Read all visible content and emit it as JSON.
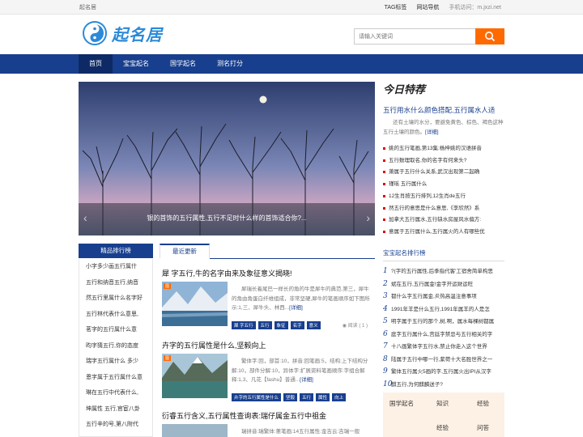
{
  "topbar": {
    "site": "起名居",
    "tag_link": "TAG标签",
    "site_nav": "网站导航",
    "mobile": "手机访问：m.jxzi.net"
  },
  "header": {
    "logo_text": "起名居",
    "search_placeholder": "请输入关键词"
  },
  "nav": [
    "首页",
    "宝宝起名",
    "国学起名",
    "测名打分"
  ],
  "banner": {
    "caption": "银的首饰的五行属性,五行不足时什么样的首饰适合你?..."
  },
  "today": {
    "badge_main": "今日",
    "badge_sub": "特荐",
    "headline": "五行用水什么颜色搭配,五行属水人适",
    "summary": "还有土壤的水分，要避免黄色、棕色、褐色这种五行土壤的颜色。",
    "more": "[详细]",
    "items": [
      "姚的五行笔画,第13集:杨梓姚的汉语拼音",
      "五行数理取名,你的名字有何来头?",
      "萧属于五行什么关系,武汉出现第二起确",
      "瑾瑶 五行属什么",
      "12生肖按五行排列,12生肖de五行",
      "然五行的意思是什么意思,《李欣然》系",
      "加拿大五行属水,五行缺水房屋风水偏方:",
      "意属于五行属什么,五行属火的人有哪些优"
    ]
  },
  "ranking": {
    "title": "宝宝起名排行榜",
    "items": [
      {
        "n": "1",
        "t": "?(字的五行属性,后季指代客'工宿舍简单构思"
      },
      {
        "n": "2",
        "t": "斌在五行,五行属金!金字开运财运旺"
      },
      {
        "n": "3",
        "t": "都什么字五行属金,炎热高温注意事项"
      },
      {
        "n": "4",
        "t": "1991年羊是什么五行,1991年属羊的人是怎"
      },
      {
        "n": "5",
        "t": "明字属于五行的那个,树,啊，属水每棵树都属"
      },
      {
        "n": "6",
        "t": "庭字五行属什么,宫廷字禁忌与五行相关的字"
      },
      {
        "n": "7",
        "t": "十八画繁体字五行水,禁止你走入这个世界"
      },
      {
        "n": "8",
        "t": "陆属于五行中哪一行,紫荷十大名胜世界之一"
      },
      {
        "n": "9",
        "t": "繁体五行属火5画的字,五行属火出IPI从汉字"
      },
      {
        "n": "10",
        "t": "麒五行,为何麒麟送子?"
      }
    ]
  },
  "tags": [
    "国学起名",
    "知识",
    "经验",
    "经验",
    "问答"
  ],
  "left": {
    "title": "精品排行榜",
    "items": [
      "小字多少画五行属什",
      "五行和纳音五行,纳音",
      "然五行里属什么名字好",
      "五行林代表什么意思,",
      "茗字的五行属什么意",
      "昀字猜五行,你的态度",
      "瑞字五行属什么 多少",
      "恩字属于五行属什么意",
      "琳在五行中代表什么,",
      "坤属性 五行,官宦八卦",
      "五行辛的号,第八附代",
      "五行火的行业有哪些"
    ]
  },
  "center": {
    "tab": "最近更新",
    "articles": [
      {
        "title": "犀 字五行,牛的名字由来及象征意义揭晓!",
        "flag": "图",
        "desc": "犀瑞长着尾巴一样长的角的牛是犀牛的典范,第三，犀牛的角由角蛋白纤维组成，非常坚硬,犀牛的笔画顺序如下图所示:1,三、犀牛头、林西...",
        "more": "[详细]",
        "tags": [
          "犀 字五行",
          "五行",
          "象征",
          "名字",
          "意义"
        ],
        "read": "阅读 ( 1 )"
      },
      {
        "title": "卉字的五行属性是什么,坚毅向上",
        "flag": "图",
        "desc": "繁体字:回，部首:10，拼音:回笔画:5，结构:上下结构分解:10，部件分解:10，异体字:扩展资料笔画顺序:字组合解释:1,3、凡花【fashu】普通...",
        "more": "[详细]",
        "tags": [
          "卉字的五行属性是什么",
          "坚毅",
          "五行",
          "属性",
          "向上"
        ],
        "read": ""
      },
      {
        "title": "衍睿五行含义,五行属性查询表:瑞仔属金五行中祖金",
        "flag": "",
        "desc": "瑞拼音:瑞繁体:蔥笔画:14五行属性:金吉云:吉瑞一般",
        "more": "",
        "tags": [],
        "read": ""
      }
    ]
  }
}
